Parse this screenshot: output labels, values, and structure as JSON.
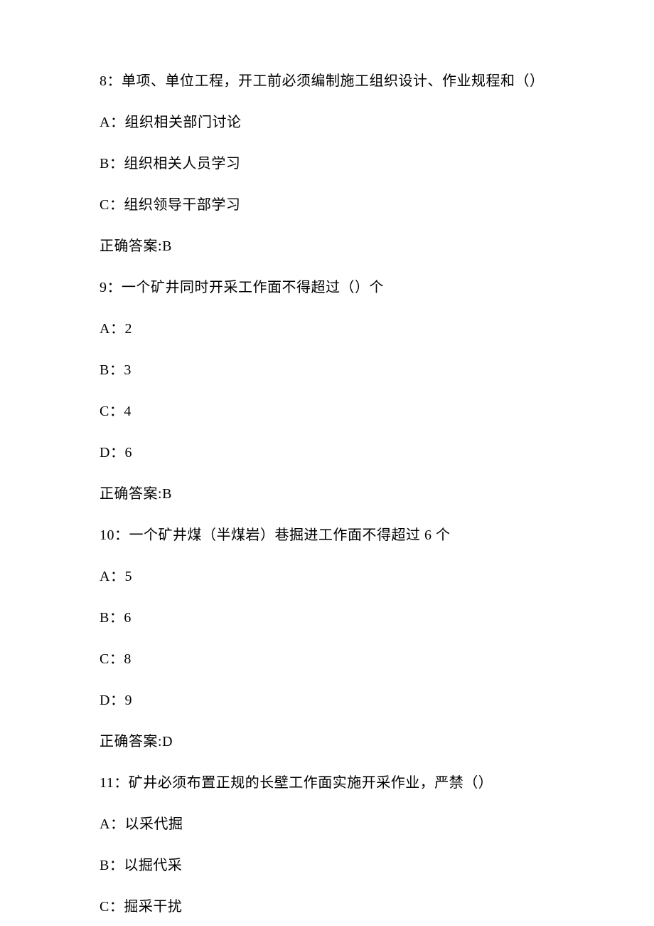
{
  "questions": [
    {
      "number": "8",
      "stem": "单项、单位工程，开工前必须编制施工组织设计、作业规程和（）",
      "options": [
        {
          "label": "A",
          "text": "组织相关部门讨论"
        },
        {
          "label": "B",
          "text": "组织相关人员学习"
        },
        {
          "label": "C",
          "text": "组织领导干部学习"
        }
      ],
      "answer_prefix": "正确答案:",
      "answer": "B"
    },
    {
      "number": "9",
      "stem": "一个矿井同时开采工作面不得超过（）个",
      "options": [
        {
          "label": "A",
          "text": "2"
        },
        {
          "label": "B",
          "text": "3"
        },
        {
          "label": "C",
          "text": "4"
        },
        {
          "label": "D",
          "text": "6"
        }
      ],
      "answer_prefix": "正确答案:",
      "answer": "B"
    },
    {
      "number": "10",
      "stem": "一个矿井煤（半煤岩）巷掘进工作面不得超过 6 个",
      "options": [
        {
          "label": "A",
          "text": "5"
        },
        {
          "label": "B",
          "text": "6"
        },
        {
          "label": "C",
          "text": "8"
        },
        {
          "label": "D",
          "text": "9"
        }
      ],
      "answer_prefix": "正确答案:",
      "answer": "D"
    },
    {
      "number": "11",
      "stem": "矿井必须布置正规的长壁工作面实施开采作业，严禁（）",
      "options": [
        {
          "label": "A",
          "text": "以采代掘"
        },
        {
          "label": "B",
          "text": "以掘代采"
        },
        {
          "label": "C",
          "text": "掘采干扰"
        }
      ],
      "answer_prefix": null,
      "answer": null
    }
  ]
}
